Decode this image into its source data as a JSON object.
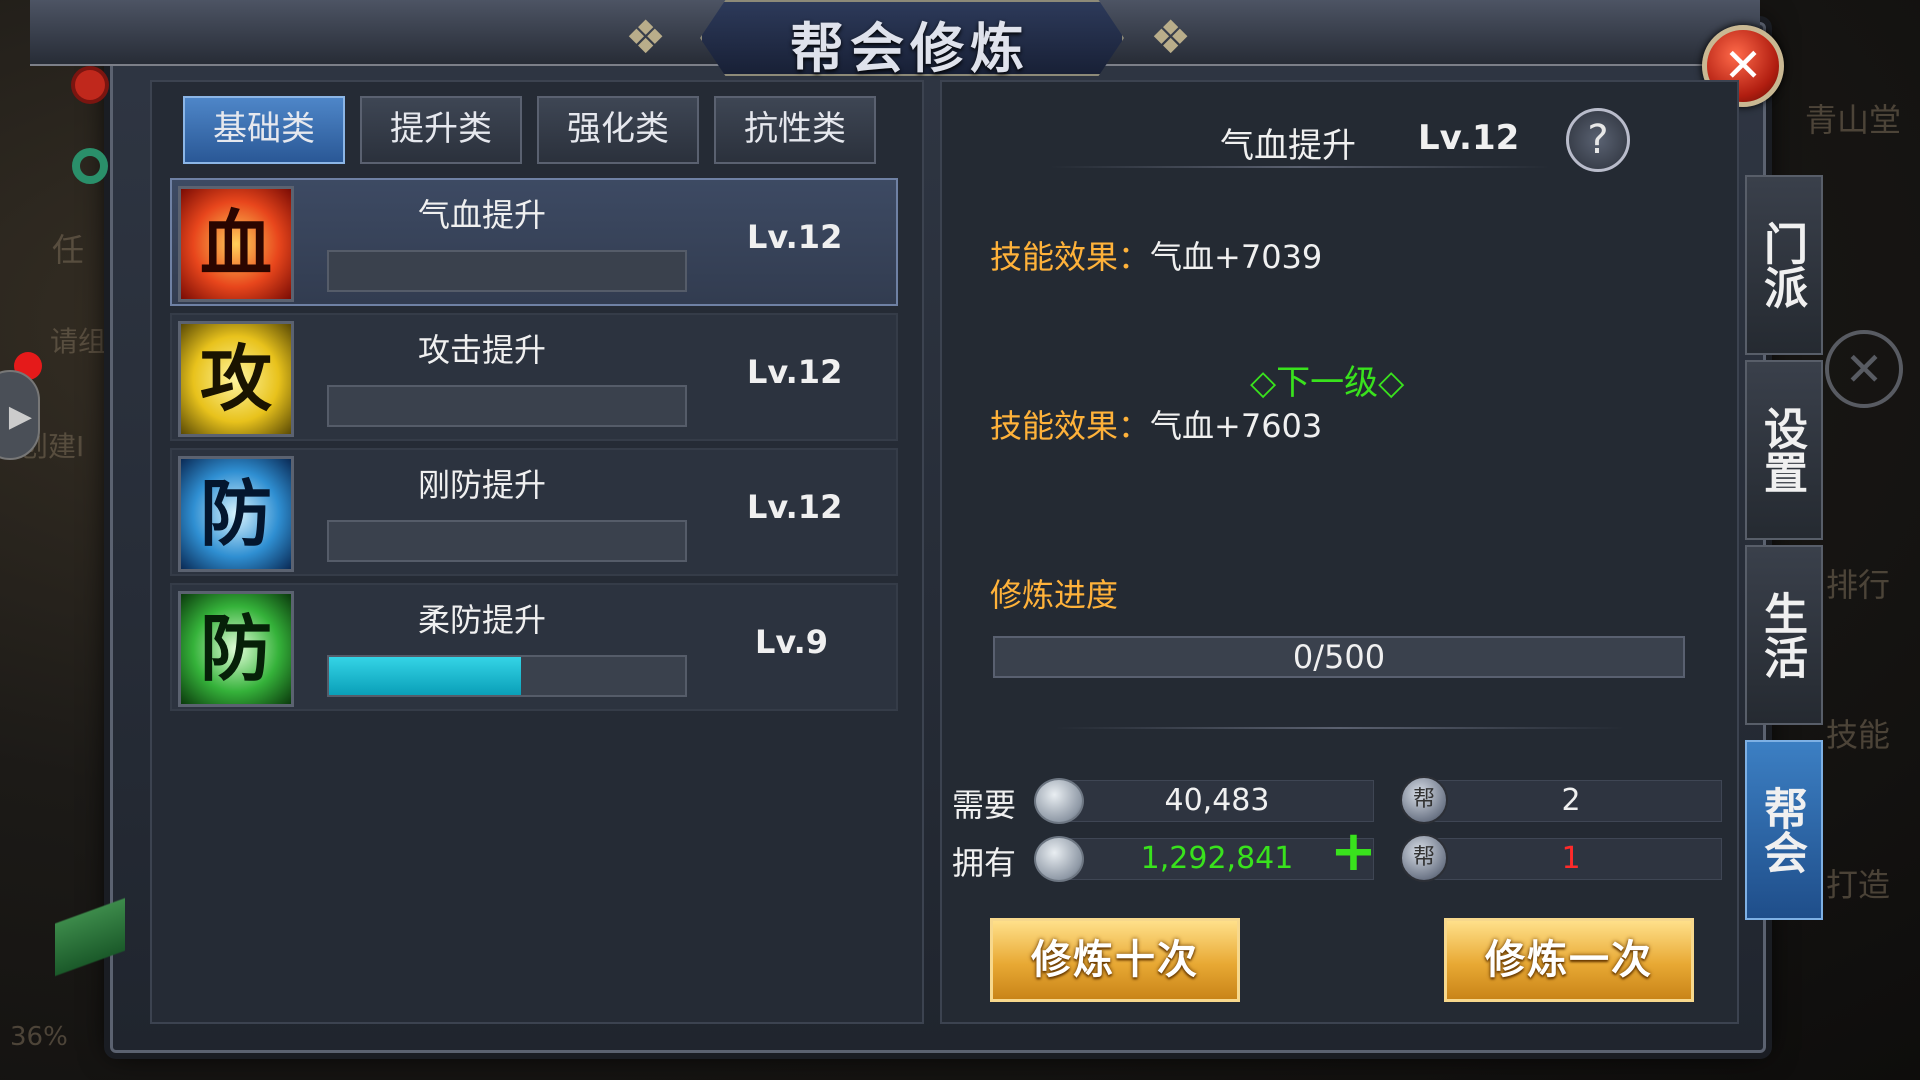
{
  "window": {
    "title": "帮会修炼",
    "close_label": "✕"
  },
  "tabs": [
    {
      "label": "基础类",
      "active": true
    },
    {
      "label": "提升类",
      "active": false
    },
    {
      "label": "强化类",
      "active": false
    },
    {
      "label": "抗性类",
      "active": false
    }
  ],
  "skills": [
    {
      "name": "气血提升",
      "level": "Lv.12",
      "icon_char": "血",
      "icon": "blood-icon",
      "progress": 0,
      "selected": true
    },
    {
      "name": "攻击提升",
      "level": "Lv.12",
      "icon_char": "攻",
      "icon": "attack-icon",
      "progress": 0,
      "selected": false
    },
    {
      "name": "刚防提升",
      "level": "Lv.12",
      "icon_char": "防",
      "icon": "hard-defense-icon",
      "progress": 0,
      "selected": false
    },
    {
      "name": "柔防提升",
      "level": "Lv.9",
      "icon_char": "防",
      "icon": "soft-defense-icon",
      "progress": 0.54,
      "selected": false
    }
  ],
  "detail": {
    "skill_name": "气血提升",
    "level": "Lv.12",
    "help_label": "?",
    "effect_label": "技能效果：",
    "effect_value": "气血+7039",
    "next_level_label": "◇下一级◇",
    "next_effect_label": "技能效果：",
    "next_effect_value": "气血+7603",
    "progress_label": "修炼进度",
    "progress_text": "0/500"
  },
  "cost": {
    "need_label": "需要",
    "own_label": "拥有",
    "need_silver": "40,483",
    "own_silver": "1,292,841",
    "need_token": "2",
    "own_token": "1",
    "add_label": "+"
  },
  "buttons": {
    "train_ten": "修炼十次",
    "train_once": "修炼一次"
  },
  "side_tabs": [
    {
      "label": "门派",
      "active": false
    },
    {
      "label": "设置",
      "active": false
    },
    {
      "label": "生活",
      "active": false
    },
    {
      "label": "帮会",
      "active": true
    }
  ],
  "background": {
    "left_texts": [
      "任",
      "请组",
      "创建I"
    ],
    "right_texts": [
      "青山堂",
      "排行",
      "技能",
      "打造"
    ],
    "battery": "36%"
  },
  "colors": {
    "accent_blue": "#2a5896",
    "orange_text": "#ffb23a",
    "green_text": "#39e21d",
    "red_text": "#ff2a2a",
    "progress_cyan": "#1ab6cf"
  }
}
